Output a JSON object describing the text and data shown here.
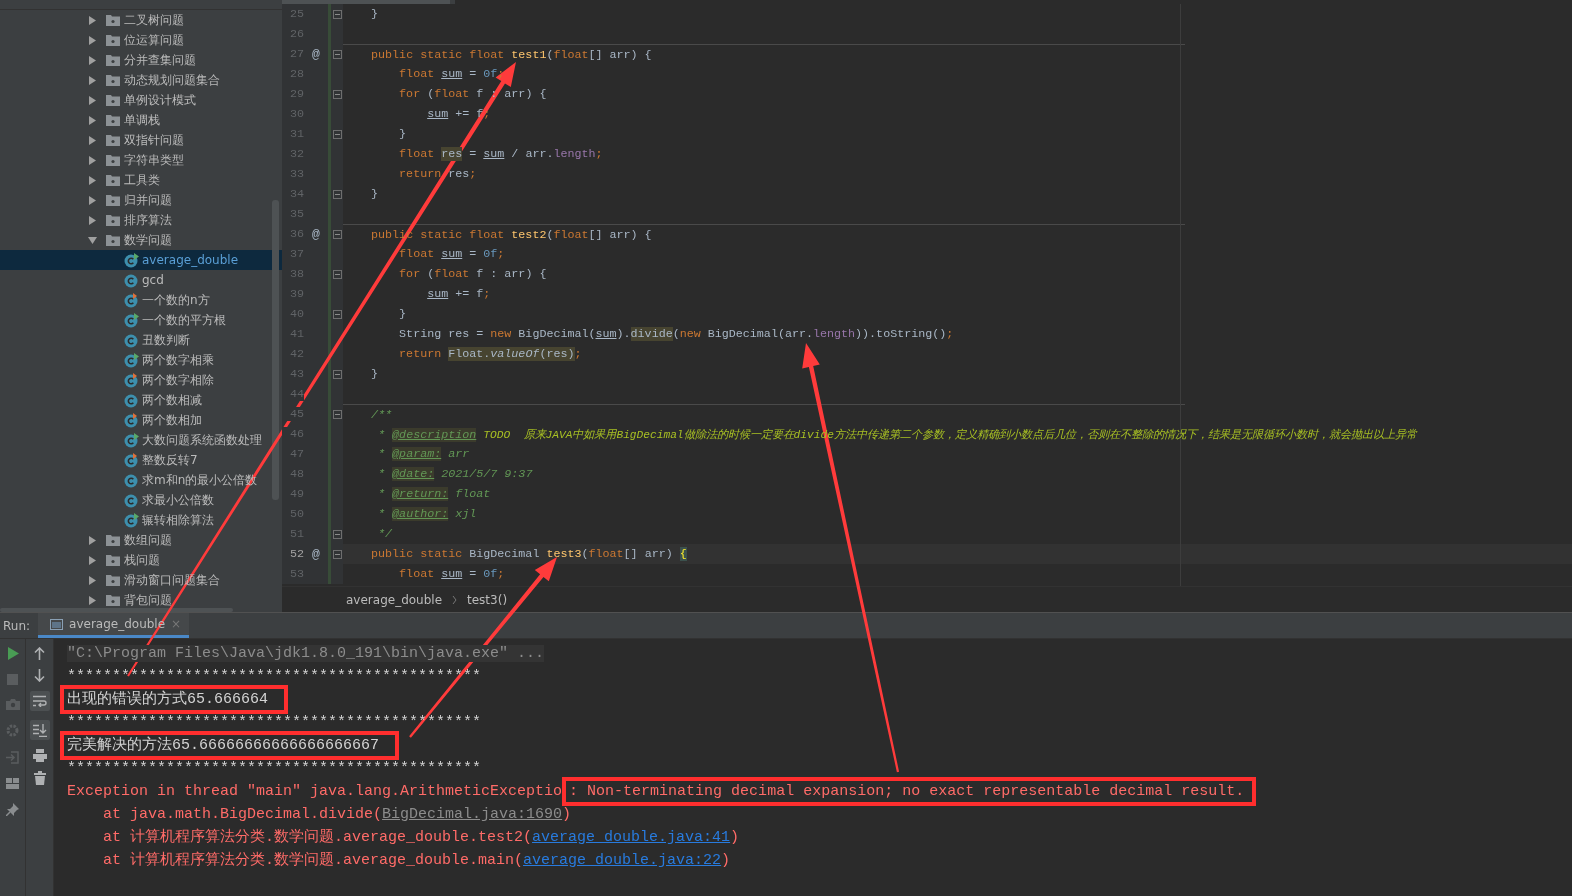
{
  "project_tree": {
    "items": [
      {
        "label": "二叉树问题",
        "kind": "folder",
        "expanded": false,
        "selected": false
      },
      {
        "label": "位运算问题",
        "kind": "folder",
        "expanded": false,
        "selected": false
      },
      {
        "label": "分并查集问题",
        "kind": "folder",
        "expanded": false,
        "selected": false
      },
      {
        "label": "动态规划问题集合",
        "kind": "folder",
        "expanded": false,
        "selected": false
      },
      {
        "label": "单例设计模式",
        "kind": "folder",
        "expanded": false,
        "selected": false
      },
      {
        "label": "单调栈",
        "kind": "folder",
        "expanded": false,
        "selected": false
      },
      {
        "label": "双指针问题",
        "kind": "folder",
        "expanded": false,
        "selected": false
      },
      {
        "label": "字符串类型",
        "kind": "folder",
        "expanded": false,
        "selected": false
      },
      {
        "label": "工具类",
        "kind": "folder",
        "expanded": false,
        "selected": false
      },
      {
        "label": "归并问题",
        "kind": "folder",
        "expanded": false,
        "selected": false
      },
      {
        "label": "排序算法",
        "kind": "folder",
        "expanded": false,
        "selected": false
      },
      {
        "label": "数学问题",
        "kind": "folder",
        "expanded": true,
        "selected": false,
        "children": [
          {
            "label": "average_double",
            "kind": "class",
            "runnable": true,
            "warning": false,
            "selected": true
          },
          {
            "label": "gcd",
            "kind": "class",
            "runnable": false,
            "warning": false,
            "selected": false
          },
          {
            "label": "一个数的n方",
            "kind": "class",
            "runnable": false,
            "warning": true,
            "selected": false
          },
          {
            "label": "一个数的平方根",
            "kind": "class",
            "runnable": true,
            "warning": false,
            "selected": false
          },
          {
            "label": "丑数判断",
            "kind": "class",
            "runnable": false,
            "warning": false,
            "selected": false
          },
          {
            "label": "两个数字相乘",
            "kind": "class",
            "runnable": true,
            "warning": false,
            "selected": false
          },
          {
            "label": "两个数字相除",
            "kind": "class",
            "runnable": false,
            "warning": true,
            "selected": false
          },
          {
            "label": "两个数相减",
            "kind": "class",
            "runnable": false,
            "warning": false,
            "selected": false
          },
          {
            "label": "两个数相加",
            "kind": "class",
            "runnable": false,
            "warning": true,
            "selected": false
          },
          {
            "label": "大数问题系统函数处理",
            "kind": "class",
            "runnable": true,
            "warning": false,
            "selected": false
          },
          {
            "label": "整数反转7",
            "kind": "class",
            "runnable": false,
            "warning": true,
            "selected": false
          },
          {
            "label": "求m和n的最小公倍数",
            "kind": "class",
            "runnable": false,
            "warning": false,
            "selected": false
          },
          {
            "label": "求最小公倍数",
            "kind": "class",
            "runnable": false,
            "warning": false,
            "selected": false
          },
          {
            "label": "辗转相除算法",
            "kind": "class",
            "runnable": true,
            "warning": false,
            "selected": false
          }
        ]
      },
      {
        "label": "数组问题",
        "kind": "folder",
        "expanded": false,
        "selected": false
      },
      {
        "label": "栈问题",
        "kind": "folder",
        "expanded": false,
        "selected": false
      },
      {
        "label": "滑动窗口问题集合",
        "kind": "folder",
        "expanded": false,
        "selected": false
      },
      {
        "label": "背包问题",
        "kind": "folder",
        "expanded": false,
        "selected": false
      }
    ]
  },
  "editor": {
    "lines": [
      {
        "number": "25",
        "fold": true,
        "tokens": [
          {
            "text": "    }",
            "kind": "plain"
          }
        ]
      },
      {
        "number": "26",
        "fold": false
      },
      {
        "number": "27",
        "fold": true,
        "separator": true,
        "marker": "@",
        "tokens": [
          {
            "text": "    public static float ",
            "kind": "kw"
          },
          {
            "text": "test1",
            "kind": "fn"
          },
          {
            "text": "(",
            "kind": "plain"
          },
          {
            "text": "float",
            "kind": "kw"
          },
          {
            "text": "[] arr) {",
            "kind": "plain"
          }
        ]
      },
      {
        "number": "28",
        "fold": false,
        "tokens": [
          {
            "text": "        float ",
            "kind": "kw"
          },
          {
            "text": "sum",
            "kind": "var"
          },
          {
            "text": " = ",
            "kind": "plain"
          },
          {
            "text": "0f",
            "kind": "num"
          },
          {
            "text": ";",
            "kind": "kw"
          }
        ]
      },
      {
        "number": "29",
        "fold": true,
        "tokens": [
          {
            "text": "        for ",
            "kind": "kw"
          },
          {
            "text": "(",
            "kind": "plain"
          },
          {
            "text": "float ",
            "kind": "kw"
          },
          {
            "text": "f : arr) {",
            "kind": "plain"
          }
        ]
      },
      {
        "number": "30",
        "fold": false,
        "tokens": [
          {
            "text": "            sum",
            "kind": "var"
          },
          {
            "text": " += f",
            "kind": "plain"
          },
          {
            "text": ";",
            "kind": "kw"
          }
        ]
      },
      {
        "number": "31",
        "fold": true,
        "tokens": [
          {
            "text": "        }",
            "kind": "plain"
          }
        ]
      },
      {
        "number": "32",
        "fold": false,
        "tokens": [
          {
            "text": "        float ",
            "kind": "kw"
          },
          {
            "text": "res",
            "kind": "hl"
          },
          {
            "text": " = ",
            "kind": "plain"
          },
          {
            "text": "sum",
            "kind": "var"
          },
          {
            "text": " / arr.",
            "kind": "plain"
          },
          {
            "text": "length",
            "kind": "field"
          },
          {
            "text": ";",
            "kind": "kw"
          }
        ]
      },
      {
        "number": "33",
        "fold": false,
        "tokens": [
          {
            "text": "        return ",
            "kind": "kw"
          },
          {
            "text": "res",
            "kind": "plain"
          },
          {
            "text": ";",
            "kind": "kw"
          }
        ]
      },
      {
        "number": "34",
        "fold": true,
        "tokens": [
          {
            "text": "    }",
            "kind": "plain"
          }
        ]
      },
      {
        "number": "35",
        "fold": false
      },
      {
        "number": "36",
        "fold": true,
        "separator": true,
        "marker": "@",
        "tokens": [
          {
            "text": "    public static float ",
            "kind": "kw"
          },
          {
            "text": "test2",
            "kind": "fn"
          },
          {
            "text": "(",
            "kind": "plain"
          },
          {
            "text": "float",
            "kind": "kw"
          },
          {
            "text": "[] arr) {",
            "kind": "plain"
          }
        ]
      },
      {
        "number": "37",
        "fold": false,
        "tokens": [
          {
            "text": "        float ",
            "kind": "kw"
          },
          {
            "text": "sum",
            "kind": "var"
          },
          {
            "text": " = ",
            "kind": "plain"
          },
          {
            "text": "0f",
            "kind": "num"
          },
          {
            "text": ";",
            "kind": "kw"
          }
        ]
      },
      {
        "number": "38",
        "fold": true,
        "tokens": [
          {
            "text": "        for ",
            "kind": "kw"
          },
          {
            "text": "(",
            "kind": "plain"
          },
          {
            "text": "float ",
            "kind": "kw"
          },
          {
            "text": "f : arr) {",
            "kind": "plain"
          }
        ]
      },
      {
        "number": "39",
        "fold": false,
        "tokens": [
          {
            "text": "            sum",
            "kind": "var"
          },
          {
            "text": " += f",
            "kind": "plain"
          },
          {
            "text": ";",
            "kind": "kw"
          }
        ]
      },
      {
        "number": "40",
        "fold": true,
        "tokens": [
          {
            "text": "        }",
            "kind": "plain"
          }
        ]
      },
      {
        "number": "41",
        "fold": false,
        "tokens": [
          {
            "text": "        String res = ",
            "kind": "plain"
          },
          {
            "text": "new ",
            "kind": "kw"
          },
          {
            "text": "BigDecimal(",
            "kind": "plain"
          },
          {
            "text": "sum",
            "kind": "var"
          },
          {
            "text": ").",
            "kind": "plain"
          },
          {
            "text": "divide",
            "kind": "hl"
          },
          {
            "text": "(",
            "kind": "plain"
          },
          {
            "text": "new ",
            "kind": "kw"
          },
          {
            "text": "BigDecimal(arr.",
            "kind": "plain"
          },
          {
            "text": "length",
            "kind": "field"
          },
          {
            "text": ")).toString()",
            "kind": "plain"
          },
          {
            "text": ";",
            "kind": "kw"
          }
        ]
      },
      {
        "number": "42",
        "fold": false,
        "tokens": [
          {
            "text": "        return ",
            "kind": "kw"
          },
          {
            "text": "Float.",
            "kind": "hl"
          },
          {
            "text": "valueOf",
            "kind": "hli"
          },
          {
            "text": "(res)",
            "kind": "hl"
          },
          {
            "text": ";",
            "kind": "kw"
          }
        ]
      },
      {
        "number": "43",
        "fold": true,
        "tokens": [
          {
            "text": "    }",
            "kind": "plain"
          }
        ]
      },
      {
        "number": "44",
        "fold": false
      },
      {
        "number": "45",
        "fold": true,
        "separator": true,
        "tokens": [
          {
            "text": "    /**",
            "kind": "doc"
          }
        ]
      },
      {
        "number": "46",
        "fold": false,
        "tokens": [
          {
            "text": "     * ",
            "kind": "doc"
          },
          {
            "text": "@description",
            "kind": "tag"
          },
          {
            "text": " TODO  原来JAVA中如果用BigDecimal做除法的时候一定要在divide方法中传递第二个参数，定义精确到小数点后几位，否则在不整除的情况下，结果是无限循环小数时，就会抛出以上异常",
            "kind": "todo"
          }
        ]
      },
      {
        "number": "47",
        "fold": false,
        "tokens": [
          {
            "text": "     * ",
            "kind": "doc"
          },
          {
            "text": "@param:",
            "kind": "tag"
          },
          {
            "text": " arr",
            "kind": "doc"
          }
        ]
      },
      {
        "number": "48",
        "fold": false,
        "tokens": [
          {
            "text": "     * ",
            "kind": "doc"
          },
          {
            "text": "@date:",
            "kind": "tag"
          },
          {
            "text": " 2021/5/7 9:37",
            "kind": "doc"
          }
        ]
      },
      {
        "number": "49",
        "fold": false,
        "tokens": [
          {
            "text": "     * ",
            "kind": "doc"
          },
          {
            "text": "@return:",
            "kind": "tag"
          },
          {
            "text": " float",
            "kind": "doc"
          }
        ]
      },
      {
        "number": "50",
        "fold": false,
        "tokens": [
          {
            "text": "     * ",
            "kind": "doc"
          },
          {
            "text": "@author:",
            "kind": "tag"
          },
          {
            "text": " xjl",
            "kind": "doc"
          }
        ]
      },
      {
        "number": "51",
        "fold": true,
        "tokens": [
          {
            "text": "     */",
            "kind": "doc"
          }
        ]
      },
      {
        "number": "52",
        "fold": true,
        "current": true,
        "marker": "@",
        "tokens": [
          {
            "text": "    public static ",
            "kind": "kw"
          },
          {
            "text": "BigDecimal ",
            "kind": "plain"
          },
          {
            "text": "test3",
            "kind": "fn"
          },
          {
            "text": "(",
            "kind": "plain"
          },
          {
            "text": "float",
            "kind": "kw"
          },
          {
            "text": "[] arr) ",
            "kind": "plain"
          },
          {
            "text": "{",
            "kind": "brace"
          }
        ]
      },
      {
        "number": "53",
        "fold": false,
        "tokens": [
          {
            "text": "        float ",
            "kind": "kw"
          },
          {
            "text": "sum",
            "kind": "var"
          },
          {
            "text": " = ",
            "kind": "plain"
          },
          {
            "text": "0f",
            "kind": "num"
          },
          {
            "text": ";",
            "kind": "kw"
          }
        ]
      }
    ],
    "breadcrumb": [
      "average_double",
      "test3()"
    ]
  },
  "run_panel": {
    "label": "Run:",
    "tabs": [
      {
        "label": "average_double",
        "selected": true,
        "close": "×"
      }
    ],
    "console": [
      {
        "segments": [
          {
            "text": "\"C:\\Program Files\\Java\\jdk1.8.0_191\\bin\\java.exe\" ...",
            "kind": "cmd"
          }
        ]
      },
      {
        "segments": [
          {
            "text": "**********************************************",
            "kind": "out"
          }
        ]
      },
      {
        "segments": [
          {
            "text": "出现的错误的方式65.666664",
            "kind": "out",
            "boxed": true
          }
        ]
      },
      {
        "segments": [
          {
            "text": "**********************************************",
            "kind": "out"
          }
        ]
      },
      {
        "segments": [
          {
            "text": "完美解决的方法65.66666666666666666667",
            "kind": "out",
            "boxed": true
          }
        ]
      },
      {
        "segments": [
          {
            "text": "**********************************************",
            "kind": "out"
          }
        ]
      },
      {
        "segments": [
          {
            "text": "Exception in thread \"main\" java.lang.ArithmeticExceptio",
            "kind": "err"
          },
          {
            "text": ": Non-terminating decimal expansion; no exact representable decimal result.",
            "kind": "err",
            "boxed": true
          }
        ]
      },
      {
        "segments": [
          {
            "text": "    at java.math.BigDecimal.divide(",
            "kind": "err"
          },
          {
            "text": "BigDecimal.java:1690",
            "kind": "src"
          },
          {
            "text": ")",
            "kind": "err"
          }
        ]
      },
      {
        "segments": [
          {
            "text": "    at 计算机程序算法分类.数学问题.average_double.test2(",
            "kind": "err"
          },
          {
            "text": "average_double.java:41",
            "kind": "link"
          },
          {
            "text": ")",
            "kind": "err"
          }
        ]
      },
      {
        "segments": [
          {
            "text": "    at 计算机程序算法分类.数学问题.average_double.main(",
            "kind": "err"
          },
          {
            "text": "average_double.java:22",
            "kind": "link"
          },
          {
            "text": ")",
            "kind": "err"
          }
        ]
      }
    ]
  }
}
